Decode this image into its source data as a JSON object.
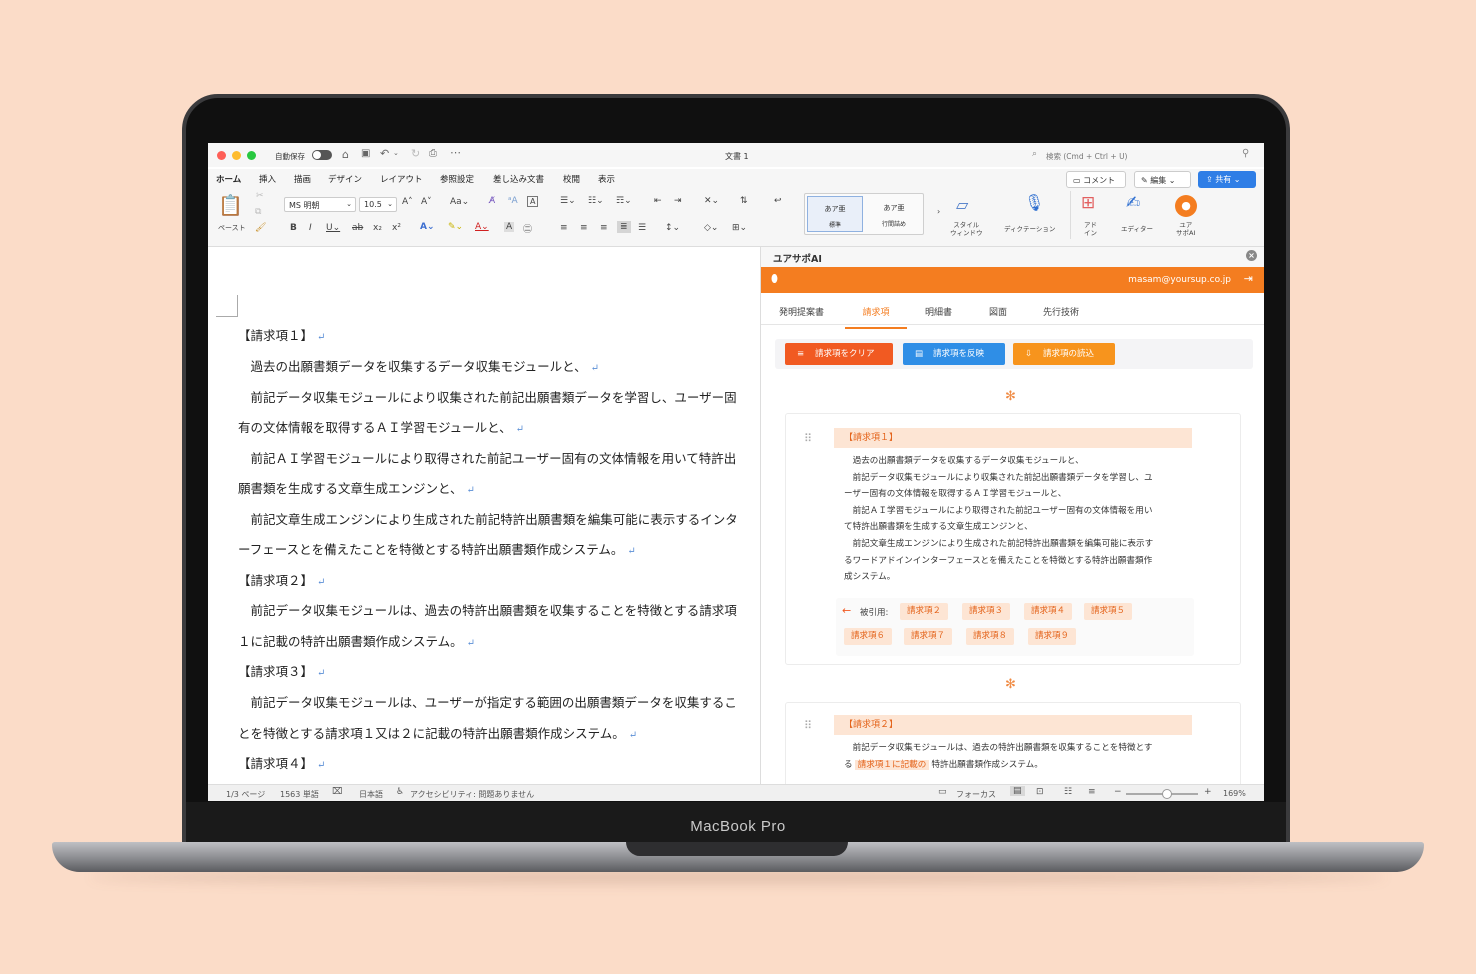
{
  "device": {
    "label": "MacBook Pro"
  },
  "window": {
    "title": "文書 1",
    "autosave_label": "自動保存",
    "search_placeholder": "検索 (Cmd + Ctrl + U)"
  },
  "ribbon_tabs": [
    "ホーム",
    "挿入",
    "描画",
    "デザイン",
    "レイアウト",
    "参照設定",
    "差し込み文書",
    "校閲",
    "表示"
  ],
  "ribbon": {
    "paste_label": "ペースト",
    "font_name": "MS 明朝",
    "font_size": "10.5",
    "style_normal_preview": "あア亜",
    "style_normal_label": "標準",
    "style_tight_preview": "あア亜",
    "style_tight_label": "行間詰め",
    "style_window_label": "スタイル\nウィンドウ",
    "dictation_label": "ディクテーション",
    "addin_label": "アド\nイン",
    "editor_label": "エディター",
    "yoursup_label": "ユア\nサポAI",
    "comment_label": "コメント",
    "edit_label": "編集",
    "share_label": "共有"
  },
  "document": {
    "lines": [
      {
        "text": "【請求項１】"
      },
      {
        "text": "　過去の出願書類データを収集するデータ収集モジュールと、"
      },
      {
        "text": "　前記データ収集モジュールにより収集された前記出願書類データを学習し、ユーザー固"
      },
      {
        "text": "有の文体情報を取得するＡＩ学習モジュールと、"
      },
      {
        "text": "　前記ＡＩ学習モジュールにより取得された前記ユーザー固有の文体情報を用いて特許出"
      },
      {
        "text": "願書類を生成する文章生成エンジンと、"
      },
      {
        "text": "　前記文章生成エンジンにより生成された前記特許出願書類を編集可能に表示するインタ"
      },
      {
        "text": "ーフェースとを備えたことを特徴とする特許出願書類作成システム。"
      },
      {
        "text": "【請求項２】"
      },
      {
        "text": "　前記データ収集モジュールは、過去の特許出願書類を収集することを特徴とする請求項"
      },
      {
        "text": "１に記載の特許出願書類作成システム。"
      },
      {
        "text": "【請求項３】"
      },
      {
        "text": "　前記データ収集モジュールは、ユーザーが指定する範囲の出願書類データを収集するこ"
      },
      {
        "text": "とを特徴とする請求項１又は２に記載の特許出願書類作成システム。"
      },
      {
        "text": "【請求項４】"
      }
    ]
  },
  "statusbar": {
    "page": "1/3 ページ",
    "words": "1563 単語",
    "language": "日本語",
    "accessibility": "アクセシビリティ: 問題ありません",
    "focus": "フォーカス",
    "zoom": "169%"
  },
  "addin": {
    "title": "ユアサポAI",
    "user_email": "masam@yoursup.co.jp",
    "tabs": [
      "発明提案書",
      "請求項",
      "明細書",
      "図面",
      "先行技術"
    ],
    "active_tab": "請求項",
    "buttons": {
      "clear": "請求項をクリア",
      "reflect": "請求項を反映",
      "load": "請求項の読込"
    },
    "claims": [
      {
        "heading": "【請求項１】",
        "lines": [
          "　過去の出願書類データを収集するデータ収集モジュールと、",
          "　前記データ収集モジュールにより収集された前記出願書類データを学習し、ユ",
          "ーザー固有の文体情報を取得するＡＩ学習モジュールと、",
          "　前記ＡＩ学習モジュールにより取得された前記ユーザー固有の文体情報を用い",
          "て特許出願書類を生成する文章生成エンジンと、",
          "　前記文章生成エンジンにより生成された前記特許出願書類を編集可能に表示す",
          "るワードアドインインターフェースとを備えたことを特徴とする特許出願書類作",
          "成システム。"
        ],
        "cited_label": "被引用:",
        "cited_by": [
          "請求項２",
          "請求項３",
          "請求項４",
          "請求項５",
          "請求項６",
          "請求項７",
          "請求項８",
          "請求項９"
        ]
      },
      {
        "heading": "【請求項２】",
        "line1": "　前記データ収集モジュールは、過去の特許出願書類を収集することを特徴とす",
        "line2_prefix": "る",
        "line2_ref": "請求項１に記載の",
        "line2_suffix": "特許出願書類作成システム。"
      }
    ]
  },
  "colors": {
    "accent_orange": "#f47d20",
    "button_clear": "#f15a22",
    "button_reflect": "#2f8ee6",
    "button_load": "#f7941d",
    "share_blue": "#2f7ee6"
  }
}
